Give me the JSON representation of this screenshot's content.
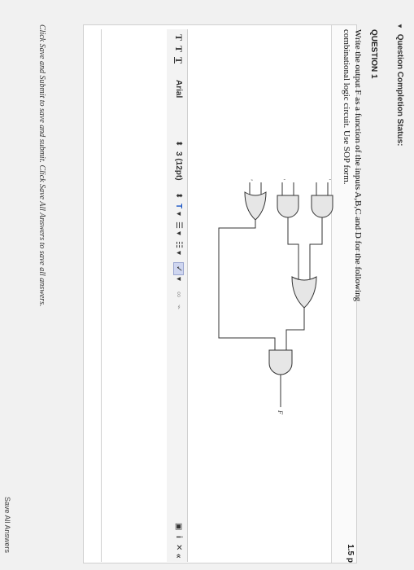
{
  "status": {
    "label": "Question Completion Status:"
  },
  "question": {
    "title": "QUESTION 1",
    "points": "1.5 p",
    "text": "Write the output F as a function of the inputs A,B,C and D for the following combinational logic circuit. Use SOP form."
  },
  "circuit": {
    "inputs": [
      "A'",
      "B",
      "A",
      "B'",
      "C",
      "D'"
    ],
    "output": "F"
  },
  "toolbar": {
    "btn_t1": "T",
    "btn_t2": "T",
    "btn_t3": "T",
    "font": "Arial",
    "size": "3 (12pt)"
  },
  "footer": {
    "note": "Click Save and Submit to save and submit. Click Save All Answers to save all answers.",
    "save_all": "Save All Answers"
  }
}
